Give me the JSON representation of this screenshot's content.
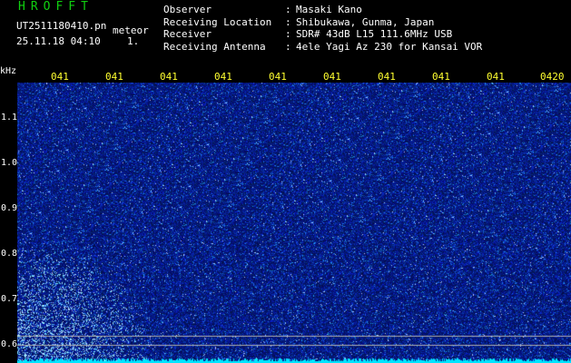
{
  "header": {
    "title": "HROFFT",
    "filename": "UT2511180410.pn",
    "mode": "meteor",
    "datetime": "25.11.18 04:10",
    "index": "1."
  },
  "meta": [
    {
      "label": "Observer",
      "value": "Masaki Kano"
    },
    {
      "label": "Receiving Location",
      "value": "Shibukawa, Gunma, Japan"
    },
    {
      "label": "Receiver",
      "value": "SDR# 43dB L15 111.6MHz USB"
    },
    {
      "label": "Receiving Antenna",
      "value": "4ele Yagi Az 230 for Kansai VOR"
    }
  ],
  "separator": ":",
  "axis": {
    "unit": "kHz",
    "time_labels": [
      "041",
      "041",
      "041",
      "041",
      "041",
      "041",
      "041",
      "041",
      "041",
      "0420"
    ],
    "freq_labels": [
      "1.1",
      "1.0",
      "0.9",
      "0.8",
      "0.7",
      "0.6"
    ]
  },
  "colors": {
    "background": "#000000",
    "title": "#10d010",
    "text": "#ffffff",
    "time_label": "#ffff30",
    "noise_base": "#0a1a8c",
    "noise_peak": "#40c8ff",
    "baseline": "#00e5ff",
    "reference_line": "#b0b0b0"
  }
}
